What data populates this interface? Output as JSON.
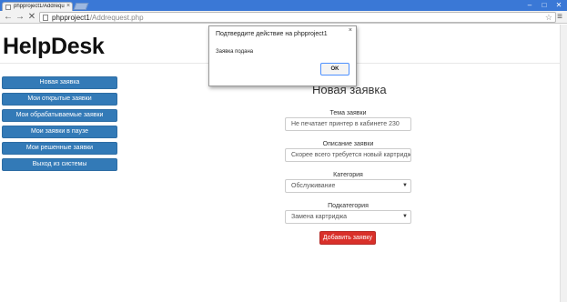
{
  "browser": {
    "tab_title": "phpproject1/Addrequest.p",
    "tab_close": "×",
    "url_host": "phpproject1",
    "url_path": "/Addrequest.php",
    "back_glyph": "←",
    "forward_glyph": "→",
    "stop_glyph": "✕",
    "star_glyph": "☆",
    "menu_glyph": "≡",
    "window_controls": {
      "minimize": "–",
      "maximize": "□",
      "close": "✕"
    }
  },
  "page": {
    "brand": "HelpDesk",
    "sidebar": {
      "items": [
        {
          "label": "Новая заявка"
        },
        {
          "label": "Мои открытые заявки"
        },
        {
          "label": "Мои обрабатываемые заявки"
        },
        {
          "label": "Мои заявки в паузе"
        },
        {
          "label": "Мои решенные заявки"
        },
        {
          "label": "Выход из системы"
        }
      ]
    },
    "form": {
      "title": "Новая заявка",
      "subject_label": "Тема заявки",
      "subject_value": "Не печатает принтер в кабинете 230",
      "description_label": "Описание заявки",
      "description_value": "Скорее всего требуется новый картридж",
      "category_label": "Категория",
      "category_value": "Обслуживание",
      "subcategory_label": "Подкатегория",
      "subcategory_value": "Замена картриджа",
      "select_arrow": "▼",
      "submit_label": "Добавить заявку"
    }
  },
  "dialog": {
    "title": "Подтвердите действие на phpproject1",
    "message": "Заявка подана",
    "ok_label": "OK",
    "close_glyph": "×"
  },
  "colors": {
    "sidebar_button": "#337ab7",
    "submit_button": "#d9302a",
    "chrome_frame": "#3a78d6"
  }
}
